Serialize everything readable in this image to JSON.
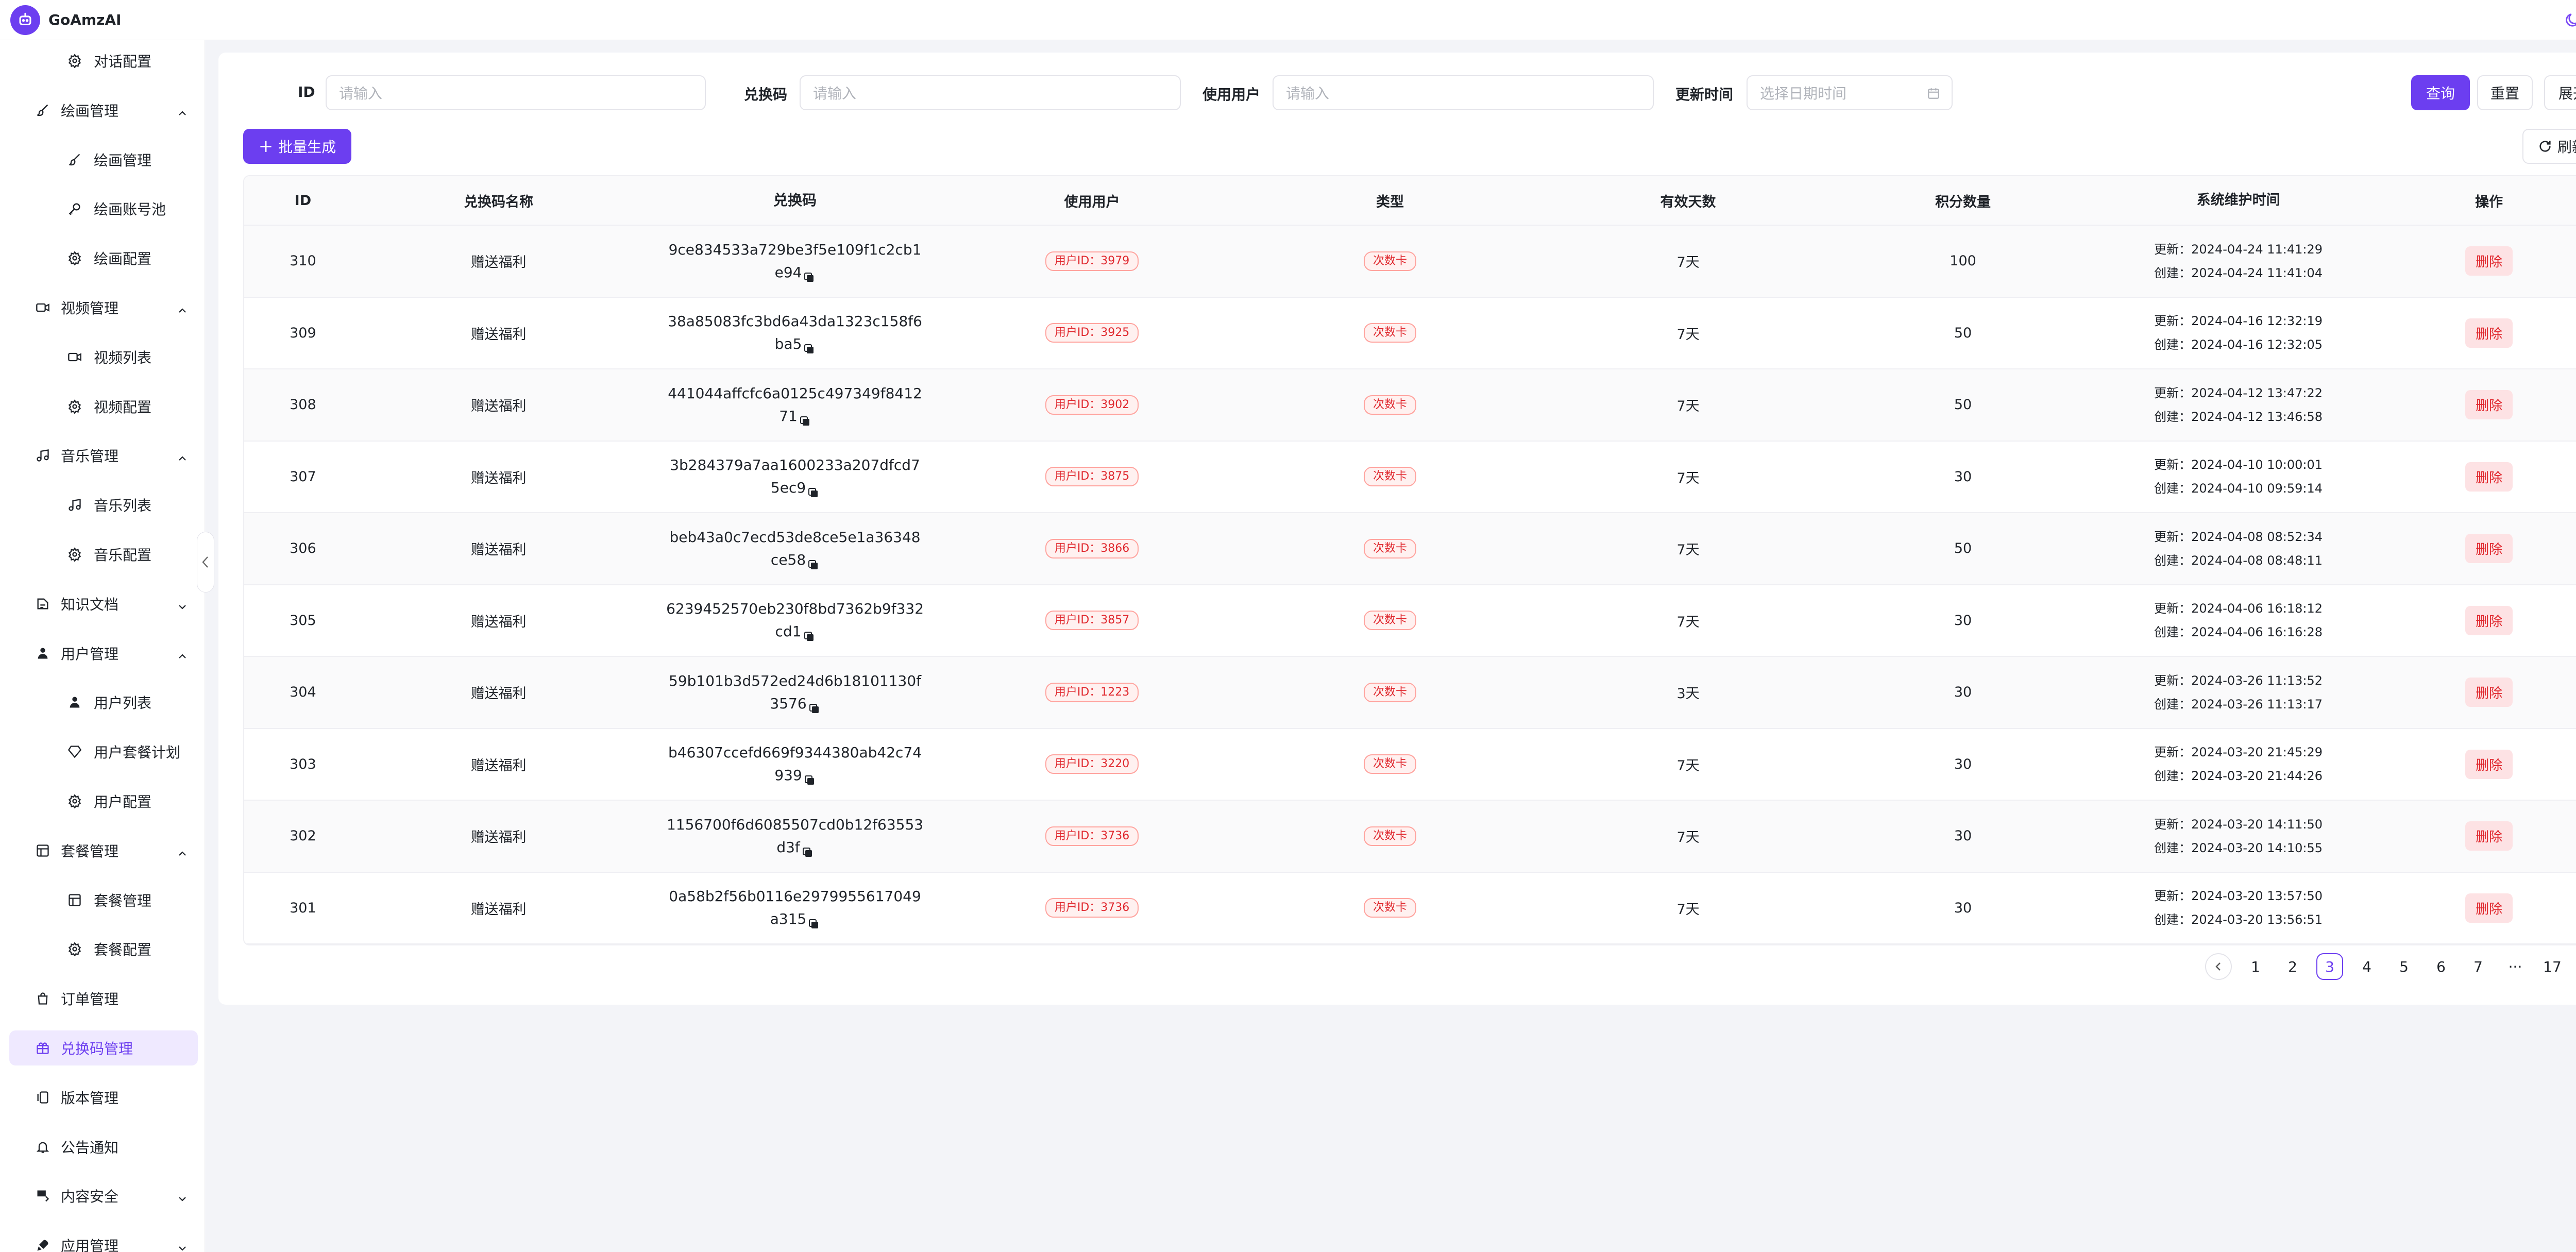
{
  "app": {
    "name": "GoAmzAI"
  },
  "sidebar": {
    "items": [
      {
        "label": "对话配置",
        "icon": "gear-icon",
        "level": "sub"
      },
      {
        "label": "绘画管理",
        "icon": "brush-icon",
        "level": "top",
        "expanded": true
      },
      {
        "label": "绘画管理",
        "icon": "brush-icon",
        "level": "sub"
      },
      {
        "label": "绘画账号池",
        "icon": "key-icon",
        "level": "sub"
      },
      {
        "label": "绘画配置",
        "icon": "gear-icon",
        "level": "sub"
      },
      {
        "label": "视频管理",
        "icon": "video-icon",
        "level": "top",
        "expanded": true
      },
      {
        "label": "视频列表",
        "icon": "video-icon",
        "level": "sub"
      },
      {
        "label": "视频配置",
        "icon": "gear-icon",
        "level": "sub"
      },
      {
        "label": "音乐管理",
        "icon": "music-icon",
        "level": "top",
        "expanded": true
      },
      {
        "label": "音乐列表",
        "icon": "music-icon",
        "level": "sub"
      },
      {
        "label": "音乐配置",
        "icon": "gear-icon",
        "level": "sub"
      },
      {
        "label": "知识文档",
        "icon": "document-icon",
        "level": "top",
        "expanded": false
      },
      {
        "label": "用户管理",
        "icon": "user-icon",
        "level": "top",
        "expanded": true
      },
      {
        "label": "用户列表",
        "icon": "user-icon",
        "level": "sub"
      },
      {
        "label": "用户套餐计划",
        "icon": "diamond-icon",
        "level": "sub"
      },
      {
        "label": "用户配置",
        "icon": "gear-icon",
        "level": "sub"
      },
      {
        "label": "套餐管理",
        "icon": "package-icon",
        "level": "top",
        "expanded": true
      },
      {
        "label": "套餐管理",
        "icon": "package-icon",
        "level": "sub"
      },
      {
        "label": "套餐配置",
        "icon": "gear-icon",
        "level": "sub"
      },
      {
        "label": "订单管理",
        "icon": "bag-icon",
        "level": "top"
      },
      {
        "label": "兑换码管理",
        "icon": "gift-icon",
        "level": "top",
        "active": true
      },
      {
        "label": "版本管理",
        "icon": "version-icon",
        "level": "top"
      },
      {
        "label": "公告通知",
        "icon": "bell-icon",
        "level": "top"
      },
      {
        "label": "内容安全",
        "icon": "shield-icon",
        "level": "top",
        "expanded": false
      },
      {
        "label": "应用管理",
        "icon": "rocket-icon",
        "level": "top",
        "expanded": false
      }
    ]
  },
  "filters": {
    "id": {
      "label": "ID",
      "placeholder": "请输入"
    },
    "code": {
      "label": "兑换码",
      "placeholder": "请输入"
    },
    "user": {
      "label": "使用用户",
      "placeholder": "请输入"
    },
    "updated": {
      "label": "更新时间",
      "placeholder": "选择日期时间"
    }
  },
  "buttons": {
    "query": "查询",
    "reset": "重置",
    "expand": "展开",
    "batch_generate": "批量生成",
    "refresh": "刷新"
  },
  "table": {
    "columns": [
      "ID",
      "兑换码名称",
      "兑换码",
      "使用用户",
      "类型",
      "有效天数",
      "积分数量",
      "系统维护时间",
      "操作"
    ],
    "rows": [
      {
        "id": "310",
        "name": "赠送福利",
        "code": "9ce834533a729be3f5e109f1c2cb1e94",
        "user": "用户ID：3979",
        "type": "次数卡",
        "days": "7天",
        "points": "100",
        "updated": "更新：2024-04-24 11:41:29",
        "created": "创建：2024-04-24 11:41:04",
        "op": "删除"
      },
      {
        "id": "309",
        "name": "赠送福利",
        "code": "38a85083fc3bd6a43da1323c158f6ba5",
        "user": "用户ID：3925",
        "type": "次数卡",
        "days": "7天",
        "points": "50",
        "updated": "更新：2024-04-16 12:32:19",
        "created": "创建：2024-04-16 12:32:05",
        "op": "删除"
      },
      {
        "id": "308",
        "name": "赠送福利",
        "code": "441044affcfc6a0125c497349f841271",
        "user": "用户ID：3902",
        "type": "次数卡",
        "days": "7天",
        "points": "50",
        "updated": "更新：2024-04-12 13:47:22",
        "created": "创建：2024-04-12 13:46:58",
        "op": "删除"
      },
      {
        "id": "307",
        "name": "赠送福利",
        "code": "3b284379a7aa1600233a207dfcd75ec9",
        "user": "用户ID：3875",
        "type": "次数卡",
        "days": "7天",
        "points": "30",
        "updated": "更新：2024-04-10 10:00:01",
        "created": "创建：2024-04-10 09:59:14",
        "op": "删除"
      },
      {
        "id": "306",
        "name": "赠送福利",
        "code": "beb43a0c7ecd53de8ce5e1a36348ce58",
        "user": "用户ID：3866",
        "type": "次数卡",
        "days": "7天",
        "points": "50",
        "updated": "更新：2024-04-08 08:52:34",
        "created": "创建：2024-04-08 08:48:11",
        "op": "删除"
      },
      {
        "id": "305",
        "name": "赠送福利",
        "code": "6239452570eb230f8bd7362b9f332cd1",
        "user": "用户ID：3857",
        "type": "次数卡",
        "days": "7天",
        "points": "30",
        "updated": "更新：2024-04-06 16:18:12",
        "created": "创建：2024-04-06 16:16:28",
        "op": "删除"
      },
      {
        "id": "304",
        "name": "赠送福利",
        "code": "59b101b3d572ed24d6b18101130f3576",
        "user": "用户ID：1223",
        "type": "次数卡",
        "days": "3天",
        "points": "30",
        "updated": "更新：2024-03-26 11:13:52",
        "created": "创建：2024-03-26 11:13:17",
        "op": "删除"
      },
      {
        "id": "303",
        "name": "赠送福利",
        "code": "b46307ccefd669f9344380ab42c74939",
        "user": "用户ID：3220",
        "type": "次数卡",
        "days": "7天",
        "points": "30",
        "updated": "更新：2024-03-20 21:45:29",
        "created": "创建：2024-03-20 21:44:26",
        "op": "删除"
      },
      {
        "id": "302",
        "name": "赠送福利",
        "code": "1156700f6d6085507cd0b12f63553d3f",
        "user": "用户ID：3736",
        "type": "次数卡",
        "days": "7天",
        "points": "30",
        "updated": "更新：2024-03-20 14:11:50",
        "created": "创建：2024-03-20 14:10:55",
        "op": "删除"
      },
      {
        "id": "301",
        "name": "赠送福利",
        "code": "0a58b2f56b0116e2979955617049a315",
        "user": "用户ID：3736",
        "type": "次数卡",
        "days": "7天",
        "points": "30",
        "updated": "更新：2024-03-20 13:57:50",
        "created": "创建：2024-03-20 13:56:51",
        "op": "删除"
      }
    ]
  },
  "pagination": {
    "pages": [
      "1",
      "2",
      "3",
      "4",
      "5",
      "6",
      "7",
      "···",
      "17"
    ],
    "current": "3"
  },
  "colors": {
    "accent": "#6c3ef0",
    "danger": "#e0282e"
  }
}
